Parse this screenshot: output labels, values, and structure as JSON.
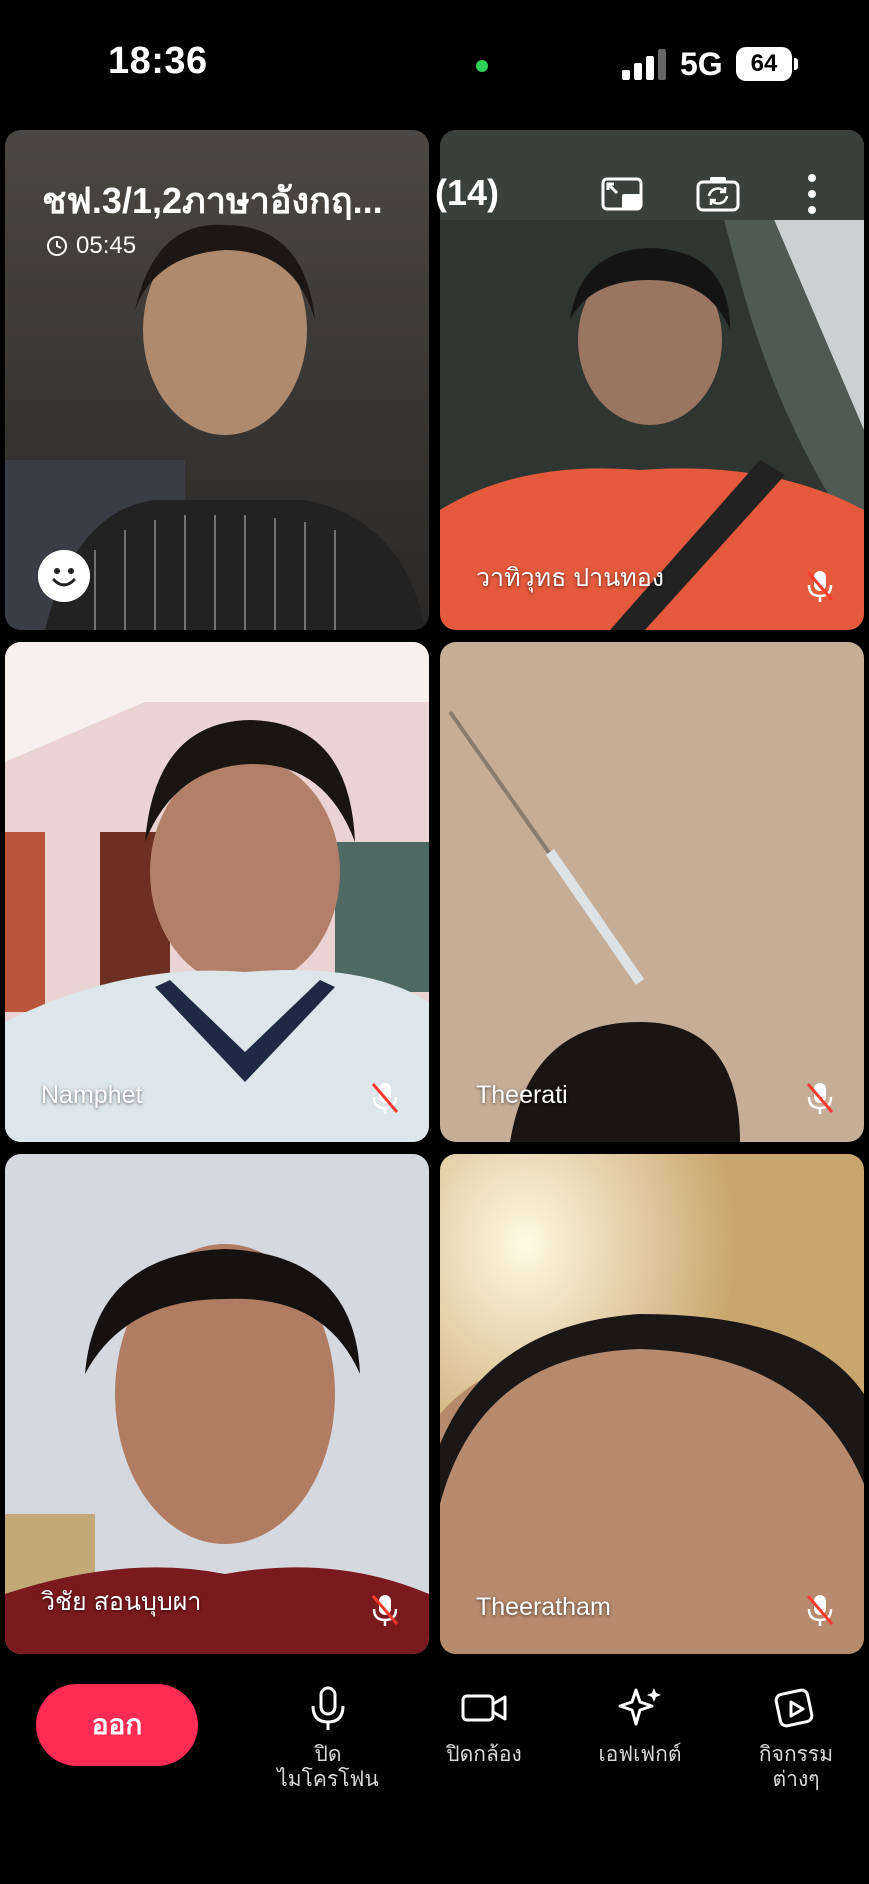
{
  "status_bar": {
    "time": "18:36",
    "network": "5G",
    "battery": "64"
  },
  "meeting": {
    "title": "ชฟ.3/1,2ภาษาอังกฤ...",
    "count": "(14)",
    "timer": "05:45"
  },
  "participants": [
    {
      "name": ""
    },
    {
      "name": "วาทิวุทธ  ปานทอง"
    },
    {
      "name": "Namphet"
    },
    {
      "name": "Theerati"
    },
    {
      "name": "วิชัย   สอนบุบผา"
    },
    {
      "name": "Theeratham"
    }
  ],
  "controls": {
    "leave": "ออก",
    "mic": "ปิด\nไมโครโฟน",
    "camera": "ปิดกล้อง",
    "effects": "เอฟเฟกต์",
    "activities": "กิจกรรม\nต่างๆ"
  },
  "colors": {
    "leave_button": "#fe2c55",
    "online_dot": "#30d158",
    "mute_slash": "#ff3b30"
  }
}
